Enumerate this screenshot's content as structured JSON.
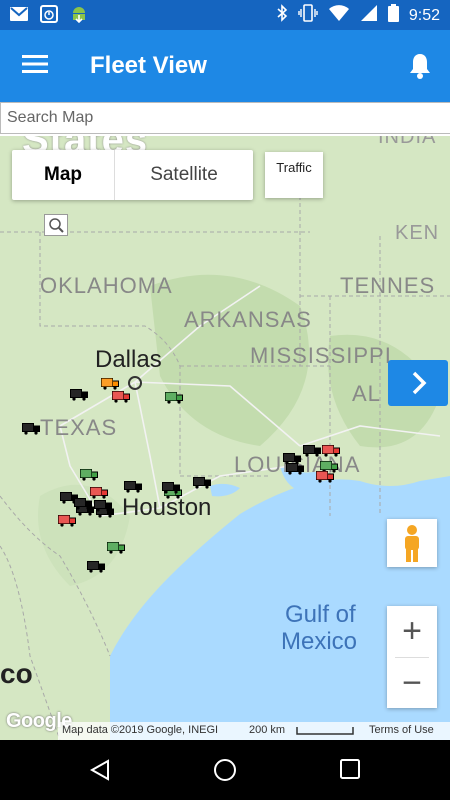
{
  "statusbar": {
    "time": "9:52",
    "left_icons": [
      "gmail-icon",
      "stopwatch-icon",
      "android-download-icon"
    ],
    "right_icons": [
      "bluetooth-icon",
      "vibrate-icon",
      "wifi-icon",
      "signal-icon",
      "battery-icon"
    ]
  },
  "appbar": {
    "title": "Fleet View"
  },
  "search": {
    "placeholder": "Search Map"
  },
  "map_controls": {
    "map_label": "Map",
    "satellite_label": "Satellite",
    "traffic_label": "Traffic",
    "zoom_in": "+",
    "zoom_out": "−"
  },
  "map_labels": {
    "states": "States",
    "oklahoma": "OKLAHOMA",
    "arkansas": "ARKANSAS",
    "mississippi": "MISSISSIPPI",
    "tennessee": "TENNES",
    "kentucky": "KEN",
    "indiana": "INDIA",
    "alabama": "AL",
    "texas": "TEXAS",
    "louisiana": "LOUISIANA",
    "dallas": "Dallas",
    "houston": "Houston",
    "gulf_line1": "Gulf of",
    "gulf_line2": "Mexico",
    "mexico_fragment": "co"
  },
  "attribution": {
    "google": "Google",
    "map_data": "Map data ©2019 Google, INEGI",
    "scale": "200 km",
    "terms": "Terms of Use"
  },
  "colors": {
    "appbar": "#1e88e5",
    "statusbar": "#1565c0",
    "water": "#aadaff",
    "land": "#d5e7c3",
    "truck_black": "#000000",
    "truck_red": "#e53935",
    "truck_green": "#43a047",
    "truck_orange": "#fb8c00"
  },
  "trucks": [
    {
      "color": "orange"
    },
    {
      "color": "black"
    },
    {
      "color": "red"
    },
    {
      "color": "green"
    },
    {
      "color": "black"
    },
    {
      "color": "green"
    },
    {
      "color": "black"
    },
    {
      "color": "green"
    },
    {
      "color": "black"
    },
    {
      "color": "red"
    },
    {
      "color": "black"
    },
    {
      "color": "black"
    },
    {
      "color": "black"
    },
    {
      "color": "red"
    },
    {
      "color": "green"
    },
    {
      "color": "black"
    },
    {
      "color": "black"
    },
    {
      "color": "black"
    },
    {
      "color": "black"
    },
    {
      "color": "black"
    },
    {
      "color": "red"
    },
    {
      "color": "green"
    },
    {
      "color": "red"
    },
    {
      "color": "black"
    },
    {
      "color": "black"
    }
  ]
}
